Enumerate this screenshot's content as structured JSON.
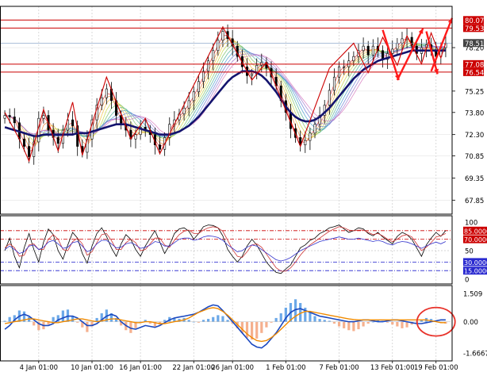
{
  "chart_data": {
    "type": "line",
    "price_panel": {
      "ylim": [
        66.9,
        81.0
      ],
      "y_ticks": [
        "80.07",
        "79.53",
        "78.20",
        "78.51",
        "77.08",
        "76.54",
        "75.25",
        "73.80",
        "72.30",
        "70.85",
        "69.35",
        "67.85"
      ],
      "current_price": "78.51",
      "current_value": 78.51,
      "levels": [
        {
          "label": "80.07",
          "value": 80.07
        },
        {
          "label": "79.53",
          "value": 79.53
        },
        {
          "label": "77.08",
          "value": 77.08
        },
        {
          "label": "76.54",
          "value": 76.54
        }
      ],
      "close": [
        73.6,
        73.5,
        73.1,
        72.0,
        71.5,
        70.8,
        71.8,
        73.4,
        73.6,
        72.6,
        72.1,
        71.7,
        72.6,
        73.3,
        72.9,
        71.5,
        71.1,
        72.0,
        73.3,
        74.3,
        74.8,
        75.4,
        74.6,
        73.6,
        73.0,
        72.6,
        72.0,
        72.3,
        72.8,
        72.6,
        72.3,
        71.6,
        71.3,
        72.1,
        73.0,
        73.3,
        73.7,
        74.1,
        74.6,
        75.2,
        75.9,
        76.6,
        77.3,
        78.0,
        78.7,
        79.3,
        78.8,
        78.3,
        77.6,
        76.9,
        76.3,
        76.4,
        77.0,
        77.2,
        76.8,
        76.2,
        75.6,
        74.6,
        73.8,
        72.7,
        72.1,
        71.6,
        71.9,
        72.4,
        73.0,
        73.6,
        74.3,
        75.3,
        76.2,
        76.9,
        76.9,
        77.3,
        77.6,
        78.0,
        78.3,
        77.7,
        78.3,
        78.0,
        77.4,
        77.8,
        78.1,
        78.5,
        78.8,
        78.9,
        78.3,
        77.8,
        78.2,
        78.4,
        78.0,
        77.6,
        78.2,
        78.51
      ],
      "ma_slow": [
        72.8,
        72.7,
        72.6,
        72.5,
        72.4,
        72.3,
        72.2,
        72.2,
        72.3,
        72.3,
        72.3,
        72.3,
        72.3,
        72.3,
        72.3,
        72.4,
        72.4,
        72.4,
        72.5,
        72.6,
        72.7,
        72.8,
        72.9,
        73.0,
        73.0,
        73.0,
        72.9,
        72.8,
        72.7,
        72.6,
        72.5,
        72.4,
        72.3,
        72.3,
        72.3,
        72.4,
        72.5,
        72.7,
        72.9,
        73.2,
        73.5,
        73.9,
        74.3,
        74.7,
        75.1,
        75.5,
        75.9,
        76.2,
        76.4,
        76.6,
        76.6,
        76.6,
        76.5,
        76.3,
        76.0,
        75.6,
        75.2,
        74.7,
        74.2,
        73.8,
        73.5,
        73.3,
        73.2,
        73.2,
        73.3,
        73.5,
        73.8,
        74.1,
        74.5,
        74.9,
        75.3,
        75.7,
        76.1,
        76.4,
        76.7,
        76.9,
        77.1,
        77.3,
        77.4,
        77.5,
        77.6,
        77.7,
        77.8,
        77.9,
        78.0,
        78.0,
        78.0,
        78.0,
        78.0,
        78.0,
        78.0,
        78.0
      ]
    },
    "rsi_panel": {
      "ylim": [
        0,
        100
      ],
      "levels": [
        {
          "label": "85.0000",
          "value": 85
        },
        {
          "label": "70.0000",
          "value": 70
        },
        {
          "label": "30.0000",
          "value": 30
        },
        {
          "label": "15.0000",
          "value": 15
        }
      ],
      "y_ticks": [
        "100",
        "50",
        "0"
      ],
      "stoch_k": [
        50,
        72,
        40,
        20,
        55,
        80,
        52,
        30,
        65,
        88,
        78,
        50,
        35,
        60,
        82,
        72,
        45,
        28,
        58,
        80,
        90,
        75,
        55,
        40,
        62,
        78,
        70,
        52,
        40,
        58,
        72,
        85,
        65,
        45,
        60,
        80,
        88,
        90,
        84,
        70,
        80,
        92,
        95,
        94,
        90,
        76,
        52,
        40,
        30,
        40,
        58,
        70,
        60,
        45,
        30,
        20,
        12,
        10,
        18,
        25,
        40,
        55,
        60,
        68,
        72,
        80,
        84,
        90,
        92,
        95,
        88,
        82,
        85,
        90,
        88,
        80,
        76,
        82,
        74,
        68,
        62,
        75,
        82,
        78,
        70,
        55,
        40,
        60,
        72,
        82,
        75,
        85
      ],
      "stoch_d": [
        55,
        62,
        55,
        40,
        42,
        60,
        62,
        52,
        52,
        70,
        78,
        70,
        52,
        50,
        66,
        72,
        62,
        42,
        48,
        64,
        78,
        80,
        68,
        52,
        52,
        64,
        70,
        64,
        50,
        52,
        62,
        72,
        72,
        60,
        56,
        68,
        78,
        84,
        86,
        80,
        80,
        86,
        90,
        92,
        90,
        84,
        68,
        52,
        40,
        38,
        48,
        60,
        62,
        56,
        44,
        32,
        20,
        14,
        14,
        20,
        30,
        42,
        52,
        60,
        66,
        72,
        78,
        84,
        88,
        92,
        90,
        86,
        85,
        86,
        86,
        82,
        78,
        80,
        76,
        70,
        66,
        70,
        76,
        78,
        74,
        62,
        50,
        56,
        64,
        74,
        76,
        80
      ],
      "rsi": [
        52,
        58,
        52,
        45,
        48,
        58,
        60,
        52,
        56,
        65,
        68,
        62,
        54,
        56,
        64,
        66,
        58,
        48,
        52,
        62,
        68,
        68,
        62,
        55,
        56,
        62,
        64,
        60,
        54,
        56,
        60,
        66,
        64,
        58,
        58,
        64,
        70,
        72,
        72,
        68,
        70,
        74,
        76,
        75,
        73,
        68,
        60,
        54,
        48,
        50,
        56,
        60,
        58,
        52,
        46,
        40,
        34,
        32,
        34,
        38,
        44,
        50,
        54,
        58,
        62,
        66,
        68,
        70,
        72,
        74,
        72,
        70,
        70,
        72,
        70,
        68,
        66,
        68,
        66,
        62,
        60,
        64,
        66,
        65,
        62,
        58,
        54,
        58,
        62,
        65,
        62,
        66
      ]
    },
    "macd_panel": {
      "ylim": [
        -1.6667,
        1.509
      ],
      "y_ticks": [
        "1.509",
        "0.00",
        "-1.6667"
      ],
      "histogram": [
        0.05,
        0.25,
        0.35,
        0.6,
        0.55,
        0.25,
        -0.2,
        -0.45,
        -0.4,
        -0.15,
        0.25,
        0.35,
        0.6,
        0.65,
        0.3,
        -0.05,
        -0.3,
        -0.55,
        -0.25,
        0.2,
        0.45,
        0.65,
        0.45,
        0.2,
        -0.2,
        -0.45,
        -0.6,
        -0.35,
        0.0,
        0.1,
        -0.1,
        -0.25,
        -0.15,
        0.1,
        0.25,
        0.2,
        0.15,
        0.2,
        0.1,
        0.0,
        -0.05,
        0.1,
        0.15,
        0.25,
        0.35,
        0.3,
        0.1,
        -0.1,
        -0.35,
        -0.6,
        -0.85,
        -0.95,
        -0.9,
        -0.6,
        -0.3,
        -0.05,
        0.2,
        0.45,
        0.75,
        1.0,
        1.2,
        1.0,
        0.75,
        0.5,
        0.3,
        0.15,
        0.1,
        0.05,
        -0.1,
        -0.25,
        -0.35,
        -0.45,
        -0.5,
        -0.4,
        -0.25,
        -0.1,
        0.0,
        0.1,
        0.05,
        -0.05,
        -0.15,
        -0.25,
        -0.35,
        -0.3,
        -0.15,
        0.0,
        0.1,
        0.2,
        0.15,
        0.05,
        -0.05,
        -0.1
      ],
      "signal": [
        -0.1,
        -0.05,
        0.0,
        0.05,
        0.1,
        0.15,
        0.15,
        0.1,
        0.05,
        0.0,
        -0.05,
        -0.05,
        0.0,
        0.05,
        0.1,
        0.15,
        0.15,
        0.1,
        0.05,
        0.0,
        0.05,
        0.1,
        0.15,
        0.15,
        0.1,
        0.05,
        0.0,
        -0.05,
        -0.05,
        0.0,
        0.0,
        -0.05,
        -0.1,
        -0.1,
        -0.05,
        0.0,
        0.05,
        0.1,
        0.2,
        0.35,
        0.5,
        0.6,
        0.7,
        0.75,
        0.7,
        0.55,
        0.35,
        0.1,
        -0.15,
        -0.4,
        -0.65,
        -0.85,
        -1.0,
        -1.05,
        -1.0,
        -0.85,
        -0.65,
        -0.4,
        -0.15,
        0.1,
        0.3,
        0.45,
        0.55,
        0.55,
        0.5,
        0.45,
        0.4,
        0.35,
        0.3,
        0.25,
        0.2,
        0.15,
        0.12,
        0.1,
        0.1,
        0.1,
        0.1,
        0.1,
        0.1,
        0.1,
        0.1,
        0.1,
        0.1,
        0.1,
        0.1,
        0.1,
        0.1,
        0.1,
        0.05,
        0.0,
        -0.05,
        -0.05
      ],
      "macd": [
        -0.4,
        -0.2,
        0.1,
        0.3,
        0.4,
        0.3,
        0.1,
        -0.1,
        -0.2,
        -0.2,
        -0.1,
        0.1,
        0.2,
        0.3,
        0.3,
        0.2,
        0.0,
        -0.2,
        -0.2,
        -0.1,
        0.1,
        0.3,
        0.4,
        0.3,
        0.0,
        -0.2,
        -0.35,
        -0.4,
        -0.3,
        -0.2,
        -0.25,
        -0.3,
        -0.2,
        -0.05,
        0.1,
        0.2,
        0.25,
        0.3,
        0.35,
        0.4,
        0.5,
        0.65,
        0.8,
        0.9,
        0.85,
        0.6,
        0.3,
        0.0,
        -0.3,
        -0.6,
        -0.9,
        -1.2,
        -1.35,
        -1.4,
        -1.2,
        -0.9,
        -0.6,
        -0.2,
        0.2,
        0.5,
        0.65,
        0.7,
        0.6,
        0.5,
        0.4,
        0.3,
        0.25,
        0.2,
        0.15,
        0.1,
        0.05,
        0.0,
        0.0,
        0.05,
        0.1,
        0.1,
        0.05,
        0.0,
        0.0,
        0.05,
        0.1,
        0.1,
        0.05,
        0.0,
        -0.05,
        -0.1,
        -0.1,
        -0.05,
        0.0,
        0.05,
        0.1,
        0.1
      ]
    },
    "x_ticks": [
      "4 Jan 01:00",
      "10 Jan 01:00",
      "16 Jan 01:00",
      "22 Jan 01:00",
      "26 Jan 01:00",
      "1 Feb 01:00",
      "7 Feb 01:00",
      "13 Feb 01:00",
      "19 Feb 01:00"
    ],
    "colors": {
      "bull": "#6ba8e8",
      "bear": "#f5b08e",
      "candle": "#000000",
      "zigzag": "#cc0000",
      "slow_ma": "#14146e",
      "level": "#cc0000",
      "current_price_bg": "#444444",
      "rsi": "#3333cc",
      "stoch_d": "#cc3333",
      "macd": "#1a48c0",
      "signal": "#f08a00",
      "annotation": "#ff1a1a"
    }
  }
}
